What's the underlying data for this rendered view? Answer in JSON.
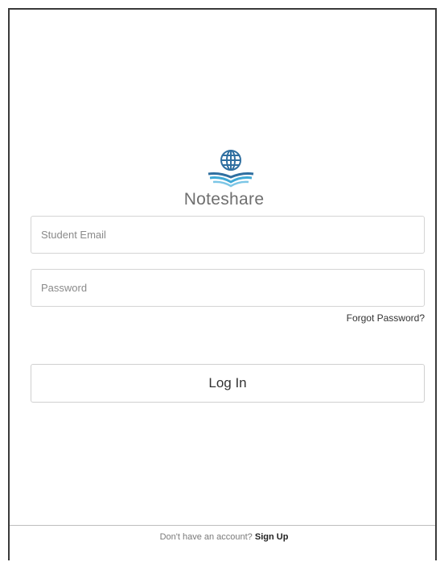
{
  "app": {
    "name": "Noteshare",
    "logo_icon": "globe-book-icon",
    "accent_color": "#2f6fa0"
  },
  "login_form": {
    "email_placeholder": "Student Email",
    "email_value": "",
    "password_placeholder": "Password",
    "password_value": "",
    "forgot_password_label": "Forgot Password?",
    "login_button_label": "Log In"
  },
  "footer": {
    "prompt_text": "Don't have an account?",
    "signup_label": "Sign Up"
  }
}
